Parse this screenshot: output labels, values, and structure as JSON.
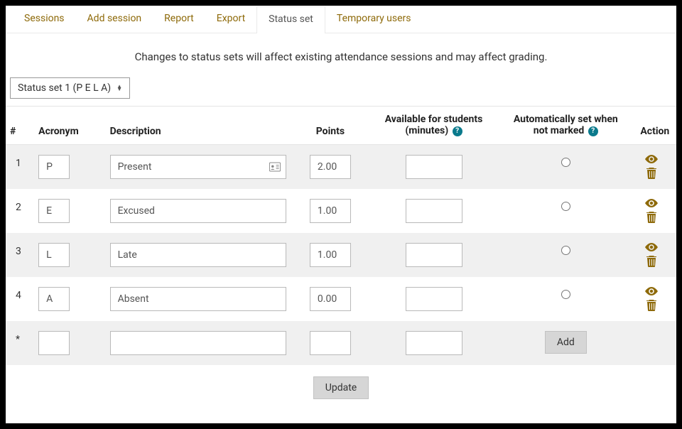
{
  "tabs": {
    "sessions": "Sessions",
    "add_session": "Add session",
    "report": "Report",
    "export": "Export",
    "status_set": "Status set",
    "temporary_users": "Temporary users"
  },
  "warning": "Changes to status sets will affect existing attendance sessions and may affect grading.",
  "dropdown": {
    "label": "Status set 1 (P E L A)"
  },
  "headers": {
    "num": "#",
    "acronym": "Acronym",
    "description": "Description",
    "points": "Points",
    "available_line1": "Available for students",
    "available_line2": "(minutes)",
    "auto_line1": "Automatically set when",
    "auto_line2": "not marked",
    "action": "Action"
  },
  "rows": [
    {
      "num": "1",
      "acronym": "P",
      "description": "Present",
      "points": "2.00",
      "minutes": "",
      "show_contact_icon": true
    },
    {
      "num": "2",
      "acronym": "E",
      "description": "Excused",
      "points": "1.00",
      "minutes": "",
      "show_contact_icon": false
    },
    {
      "num": "3",
      "acronym": "L",
      "description": "Late",
      "points": "1.00",
      "minutes": "",
      "show_contact_icon": false
    },
    {
      "num": "4",
      "acronym": "A",
      "description": "Absent",
      "points": "0.00",
      "minutes": "",
      "show_contact_icon": false
    }
  ],
  "newrow": {
    "num": "*",
    "acronym": "",
    "description": "",
    "points": "",
    "minutes": ""
  },
  "buttons": {
    "add": "Add",
    "update": "Update"
  },
  "help_char": "?"
}
